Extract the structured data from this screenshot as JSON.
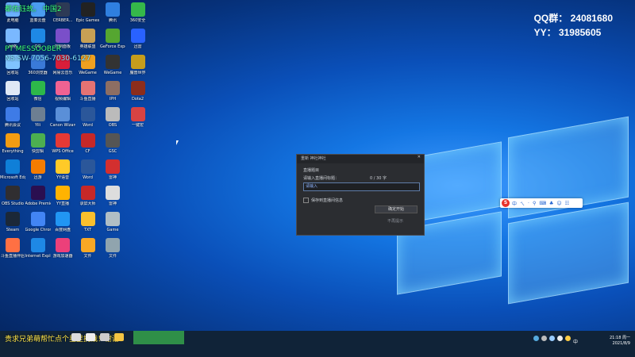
{
  "overlay": {
    "line1": "都佑钰故。 中国2",
    "line2": "PT MESSOOBER",
    "line3": "NS:SW-7056-7030-6127"
  },
  "qq_group": "QQ群： 24081680",
  "yy": "YY： 31985605",
  "desktop_icons": [
    {
      "label": "此电脑",
      "color": "#6ab0ff"
    },
    {
      "label": "蓝奏云盘",
      "color": "#4a9df0"
    },
    {
      "label": "CERBER...",
      "color": "#2d3a55"
    },
    {
      "label": "Epic Games",
      "color": "#222"
    },
    {
      "label": "腾讯",
      "color": "#2f7fe0"
    },
    {
      "label": "360安全",
      "color": "#35b84a"
    },
    {
      "label": "网络",
      "color": "#7ab8ff"
    },
    {
      "label": "QQ",
      "color": "#1e88e5"
    },
    {
      "label": "控制面板",
      "color": "#7a4fc9"
    },
    {
      "label": "英雄联盟",
      "color": "#c7a055"
    },
    {
      "label": "GeForce Experience",
      "color": "#55a630"
    },
    {
      "label": "迅雷",
      "color": "#2962ff"
    },
    {
      "label": "回收站",
      "color": "#80c4ff"
    },
    {
      "label": "360浏览器",
      "color": "#3a7ad8"
    },
    {
      "label": "网易云音乐",
      "color": "#d81e3a"
    },
    {
      "label": "WeGame",
      "color": "#f0a020"
    },
    {
      "label": "WeGame",
      "color": "#333"
    },
    {
      "label": "魔兽世界",
      "color": "#c59d1c"
    },
    {
      "label": "回收站",
      "color": "#dfe8f5"
    },
    {
      "label": "微信",
      "color": "#2db84a"
    },
    {
      "label": "视频编辑",
      "color": "#f06292"
    },
    {
      "label": "斗鱼直播",
      "color": "#e57373"
    },
    {
      "label": "IPH",
      "color": "#8d6e63"
    },
    {
      "label": "Dota2",
      "color": "#8b2d1c"
    },
    {
      "label": "腾讯会议",
      "color": "#3e7be6"
    },
    {
      "label": "Yili",
      "color": "#6d7f92"
    },
    {
      "label": "Canon Wizard",
      "color": "#5a8fd8"
    },
    {
      "label": "Word",
      "color": "#2b579a"
    },
    {
      "label": "OBS",
      "color": "#bbb"
    },
    {
      "label": "一键宏",
      "color": "#d84343"
    },
    {
      "label": "Everything",
      "color": "#f39c12"
    },
    {
      "label": "快剪辑",
      "color": "#4caf50"
    },
    {
      "label": "WPS Office",
      "color": "#e53935"
    },
    {
      "label": "CF",
      "color": "#c62828"
    },
    {
      "label": "GSC",
      "color": "#555"
    },
    {
      "label": "",
      "color": "transparent"
    },
    {
      "label": "Microsoft Edge",
      "color": "#0f7fd8"
    },
    {
      "label": "迅游",
      "color": "#f57c00"
    },
    {
      "label": "YY语音",
      "color": "#ffca28"
    },
    {
      "label": "Word",
      "color": "#2b579a"
    },
    {
      "label": "雷神",
      "color": "#d32f2f"
    },
    {
      "label": "",
      "color": "transparent"
    },
    {
      "label": "OBS Studio",
      "color": "#302e31"
    },
    {
      "label": "Adobe Premiere",
      "color": "#2a0f50"
    },
    {
      "label": "YY直播",
      "color": "#ffb300"
    },
    {
      "label": "录屏大师",
      "color": "#c62828"
    },
    {
      "label": "雷神",
      "color": "#ddd"
    },
    {
      "label": "",
      "color": "transparent"
    },
    {
      "label": "Steam",
      "color": "#1b2838"
    },
    {
      "label": "Google Chrome",
      "color": "#4285f4"
    },
    {
      "label": "百度网盘",
      "color": "#2196f3"
    },
    {
      "label": "TXT",
      "color": "#fbc02d"
    },
    {
      "label": "Game",
      "color": "#b0bec5"
    },
    {
      "label": "",
      "color": "transparent"
    },
    {
      "label": "斗鱼直播伴侣",
      "color": "#ff7043"
    },
    {
      "label": "Internet Explorer",
      "color": "#1e88e5"
    },
    {
      "label": "游戏加速器",
      "color": "#ec407a"
    },
    {
      "label": "文件",
      "color": "#f9a825"
    },
    {
      "label": "文件",
      "color": "#90a4ae"
    },
    {
      "label": "",
      "color": "transparent"
    }
  ],
  "dialog": {
    "title": "重新 神社神社",
    "label1": "直播题目",
    "label2": "请输入直播间标题：",
    "hint": "0 / 30 字",
    "input_value": "请输入",
    "checkbox_label": "保存到直播间信息",
    "button1": "确定开始",
    "button2": "不再提示"
  },
  "ime": {
    "logo": "S",
    "items": [
      "中",
      "ㄟ",
      "·",
      "⚲",
      "⌨",
      "♣",
      "☺",
      "☷"
    ]
  },
  "banner_text": "贵求兄弟萌帮忙点个星星挑战！谢谢！",
  "tray": {
    "ime_label": "中",
    "time": "21:18 周一",
    "date": "2021/8/9"
  },
  "colors": {
    "accent": "#1476e3",
    "overlay_green": "#3cff7a",
    "banner_yellow": "#ffe64a"
  }
}
